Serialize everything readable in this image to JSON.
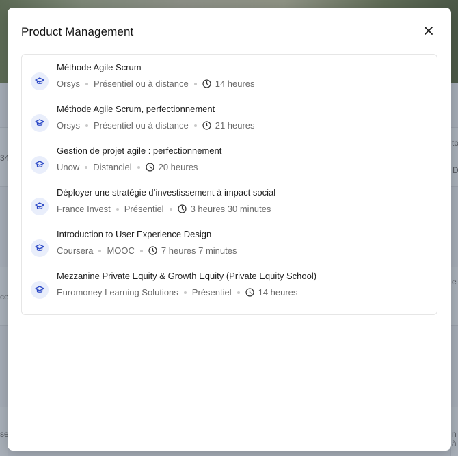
{
  "background": {
    "fragments": [
      "to",
      "34",
      "D",
      "e",
      "ce",
      "se",
      "n à"
    ]
  },
  "modal": {
    "title": "Product Management",
    "close_icon": "close-icon"
  },
  "courses": [
    {
      "title": "Méthode Agile Scrum",
      "provider": "Orsys",
      "format": "Présentiel ou à distance",
      "duration": "14 heures"
    },
    {
      "title": "Méthode Agile Scrum, perfectionnement",
      "provider": "Orsys",
      "format": "Présentiel ou à distance",
      "duration": "21 heures"
    },
    {
      "title": "Gestion de projet agile : perfectionnement",
      "provider": "Unow",
      "format": "Distanciel",
      "duration": "20 heures"
    },
    {
      "title": "Déployer une stratégie d’investissement à impact social",
      "provider": "France Invest",
      "format": "Présentiel",
      "duration": "3 heures 30 minutes"
    },
    {
      "title": "Introduction to User Experience Design",
      "provider": "Coursera",
      "format": "MOOC",
      "duration": "7 heures 7 minutes"
    },
    {
      "title": "Mezzanine Private Equity & Growth Equity (Private Equity School)",
      "provider": "Euromoney Learning Solutions",
      "format": "Présentiel",
      "duration": "14 heures"
    }
  ],
  "colors": {
    "icon_bg": "#e9eefb",
    "icon_fg": "#2b48c6",
    "title_text": "#1d1d1d",
    "meta_text": "#6a6a6a"
  }
}
